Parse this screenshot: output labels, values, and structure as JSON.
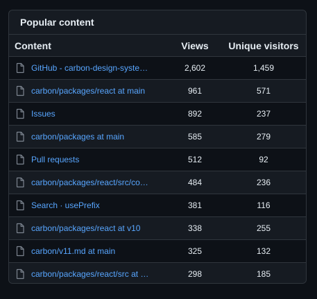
{
  "panel": {
    "title": "Popular content"
  },
  "table": {
    "headers": {
      "content": "Content",
      "views": "Views",
      "unique": "Unique visitors"
    },
    "rows": [
      {
        "content": "GitHub - carbon-design-syste…",
        "views": "2,602",
        "unique": "1,459",
        "icon": "file-icon"
      },
      {
        "content": "carbon/packages/react at main",
        "views": "961",
        "unique": "571",
        "icon": "file-icon"
      },
      {
        "content": "Issues",
        "views": "892",
        "unique": "237",
        "icon": "file-icon"
      },
      {
        "content": "carbon/packages at main",
        "views": "585",
        "unique": "279",
        "icon": "file-icon"
      },
      {
        "content": "Pull requests",
        "views": "512",
        "unique": "92",
        "icon": "file-icon"
      },
      {
        "content": "carbon/packages/react/src/co…",
        "views": "484",
        "unique": "236",
        "icon": "file-icon"
      },
      {
        "content": "Search · usePrefix",
        "views": "381",
        "unique": "116",
        "icon": "file-icon"
      },
      {
        "content": "carbon/packages/react at v10",
        "views": "338",
        "unique": "255",
        "icon": "file-icon"
      },
      {
        "content": "carbon/v11.md at main",
        "views": "325",
        "unique": "132",
        "icon": "file-icon"
      },
      {
        "content": "carbon/packages/react/src at …",
        "views": "298",
        "unique": "185",
        "icon": "file-icon"
      }
    ]
  },
  "colors": {
    "background": "#0d1117",
    "panel": "#161b22",
    "border": "#30363d",
    "text": "#e6edf3",
    "link": "#58a6ff",
    "icon": "#7d8590"
  }
}
